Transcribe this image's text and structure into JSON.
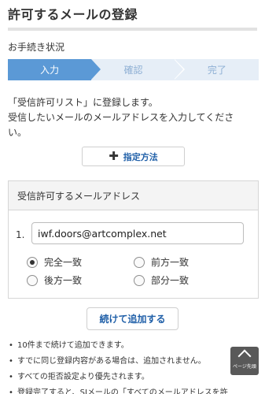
{
  "page": {
    "title": "許可するメールの登録"
  },
  "procedure": {
    "label": "お手続き状況",
    "steps": [
      {
        "label": "入力",
        "state": "active"
      },
      {
        "label": "確認",
        "state": "inactive"
      },
      {
        "label": "完了",
        "state": "inactive"
      }
    ]
  },
  "description": {
    "line1": "「受信許可リスト」に登録します。",
    "line2": "受信したいメールのメールアドレスを入力してくださ",
    "line3": "い。"
  },
  "method_button": {
    "label": "指定方法",
    "icon": "plus-icon"
  },
  "form": {
    "header": "受信許可するメールアドレス",
    "row_number": "1.",
    "email_value": "iwf.doors@artcomplex.net",
    "match_options": [
      {
        "label": "完全一致",
        "checked": true
      },
      {
        "label": "前方一致",
        "checked": false
      },
      {
        "label": "後方一致",
        "checked": false
      },
      {
        "label": "部分一致",
        "checked": false
      }
    ]
  },
  "add_button": {
    "label": "続けて追加する"
  },
  "notes": [
    "10件まで続けて追加できます。",
    "すでに同じ登録内容がある場合は、追加されません。",
    "すべての拒否設定より優先されます。",
    "登録完了すると、SIメールの「すべてのメールアドレスを許"
  ],
  "page_top": {
    "label": "ページ先頭",
    "icon": "chevron-up-icon"
  },
  "colors": {
    "accent": "#5b99d6",
    "link": "#1f5fa8",
    "step_inactive_bg": "#e6eef7"
  }
}
